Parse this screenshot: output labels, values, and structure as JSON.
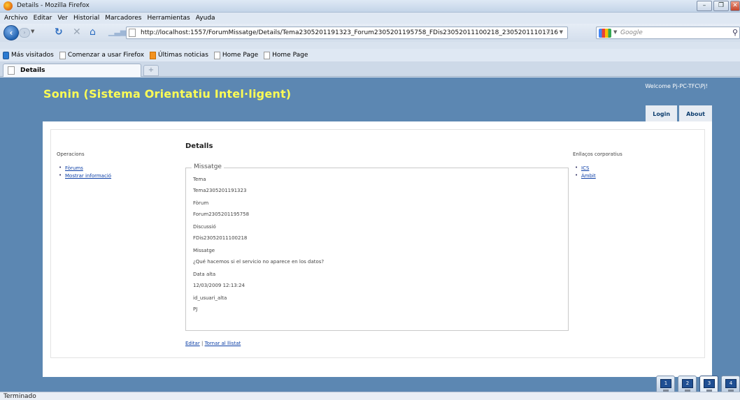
{
  "window": {
    "title": "Details - Mozilla Firefox"
  },
  "menubar": [
    "Archivo",
    "Editar",
    "Ver",
    "Historial",
    "Marcadores",
    "Herramientas",
    "Ayuda"
  ],
  "nav": {
    "url": "http://localhost:1557/ForumMissatge/Details/Tema2305201191323_Forum2305201195758_FDis23052011100218_23052011101716",
    "search_placeholder": "Google"
  },
  "bookmarks": [
    {
      "label": "Más visitados",
      "icon": "ie-icon"
    },
    {
      "label": "Comenzar a usar Firefox",
      "icon": "page-icon"
    },
    {
      "label": "Últimas noticias",
      "icon": "rss-icon"
    },
    {
      "label": "Home Page",
      "icon": "page-icon"
    },
    {
      "label": "Home Page",
      "icon": "page-icon"
    }
  ],
  "tab": {
    "label": "Details",
    "new_tab": "+"
  },
  "site": {
    "title": "Sonin (Sistema Orientatiu Intel·ligent)",
    "welcome": "Welcome Pj-PC-TFC\\Pj!",
    "nav": [
      "Login",
      "About"
    ]
  },
  "left": {
    "title": "Operacions",
    "items": [
      "Fòrums",
      "Mostrar informació"
    ]
  },
  "main": {
    "heading": "Detalls",
    "legend": "Missatge",
    "fields": [
      {
        "label": "Tema",
        "value": "Tema2305201191323"
      },
      {
        "label": "Fòrum",
        "value": "Forum2305201195758"
      },
      {
        "label": "Discussió",
        "value": "FDis23052011100218"
      },
      {
        "label": "Missatge",
        "value": "¿Qué hacemos si el servicio no aparece en los datos?"
      },
      {
        "label": "Data alta",
        "value": "12/03/2009 12:13:24"
      },
      {
        "label": "id_usuari_alta",
        "value": "PJ"
      }
    ],
    "actions": {
      "edit": "Editar",
      "separator": "|",
      "back": "Tornar al llistat"
    }
  },
  "right": {
    "title": "Enllaços corporatius",
    "items": [
      "ICS",
      "Àmbit"
    ]
  },
  "network_desktops": [
    "1",
    "2",
    "3",
    "4"
  ],
  "status": "Terminado"
}
